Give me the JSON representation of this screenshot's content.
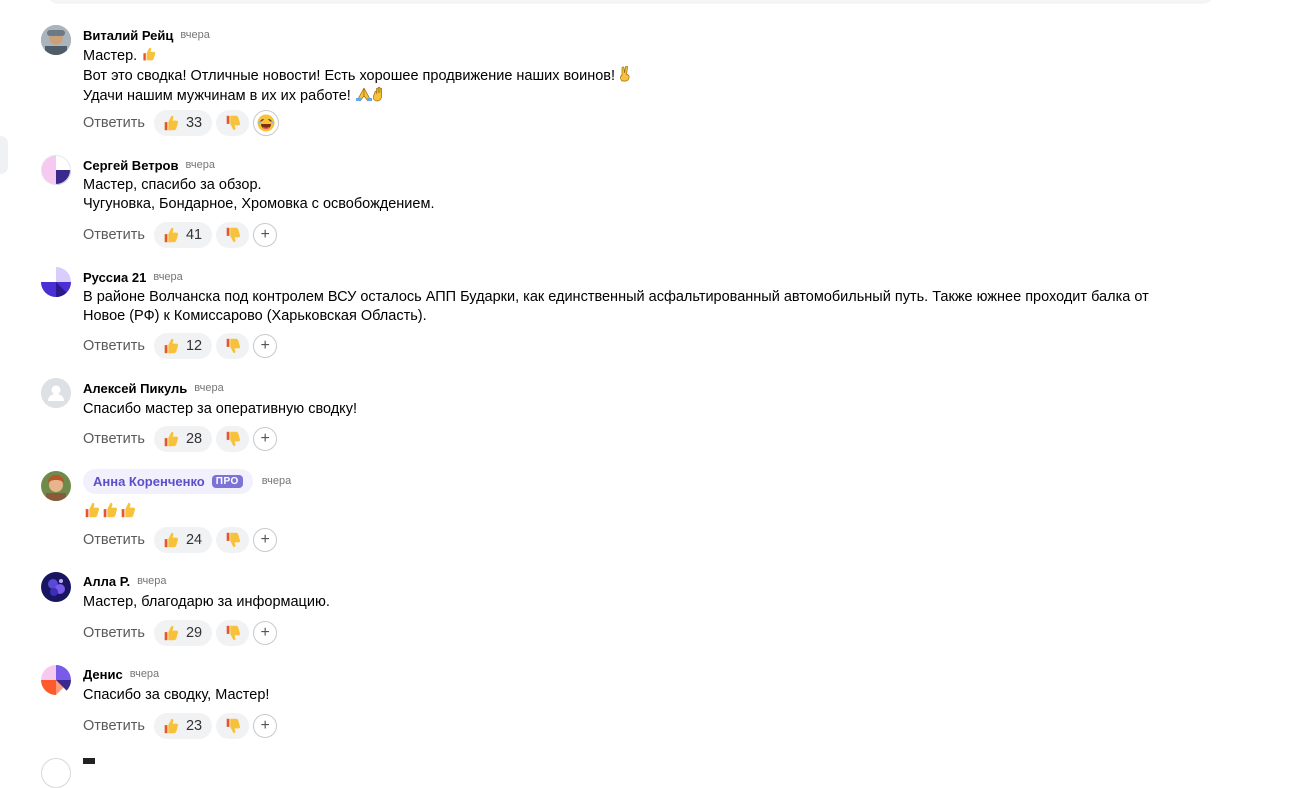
{
  "ui": {
    "reply_label": "Ответить"
  },
  "comments": [
    {
      "author": "Виталий Рейц",
      "time": "вчера",
      "lines": [
        "Мастер.",
        "Вот это сводка! Отличные новости! Есть хорошее продвижение наших воинов!",
        "Удачи нашим мужчинам в их их работе!"
      ],
      "likes": "33"
    },
    {
      "author": "Сергей Ветров",
      "time": "вчера",
      "lines": [
        "Мастер, спасибо за обзор.",
        "Чугуновка, Бондарное, Хромовка с освобождением."
      ],
      "likes": "41"
    },
    {
      "author": "Руссиа 21",
      "time": "вчера",
      "lines": [
        "В районе Волчанска под контролем ВСУ осталось АПП Бударки, как единственный асфальтированный автомобильный путь. Также южнее проходит балка от",
        "Новое (РФ) к Комиссарово (Харьковская Область)."
      ],
      "likes": "12"
    },
    {
      "author": "Алексей Пикуль",
      "time": "вчера",
      "lines": [
        "Спасибо мастер за оперативную сводку!"
      ],
      "likes": "28"
    },
    {
      "author": "Анна Коренченко",
      "badge": "ПРО",
      "time": "вчера",
      "lines": [],
      "likes": "24"
    },
    {
      "author": "Алла Р.",
      "time": "вчера",
      "lines": [
        "Мастер, благодарю за информацию."
      ],
      "likes": "29"
    },
    {
      "author": "Денис",
      "time": "вчера",
      "lines": [
        "Спасибо за сводку, Мастер!"
      ],
      "likes": "23"
    }
  ],
  "colors": {
    "pro_accent": "#7b73d6",
    "pill_bg": "#f2f0fd",
    "button_bg": "#f1f2f4",
    "thumb_yellow": "#f7c23a",
    "thumb_red": "#e8542c"
  }
}
